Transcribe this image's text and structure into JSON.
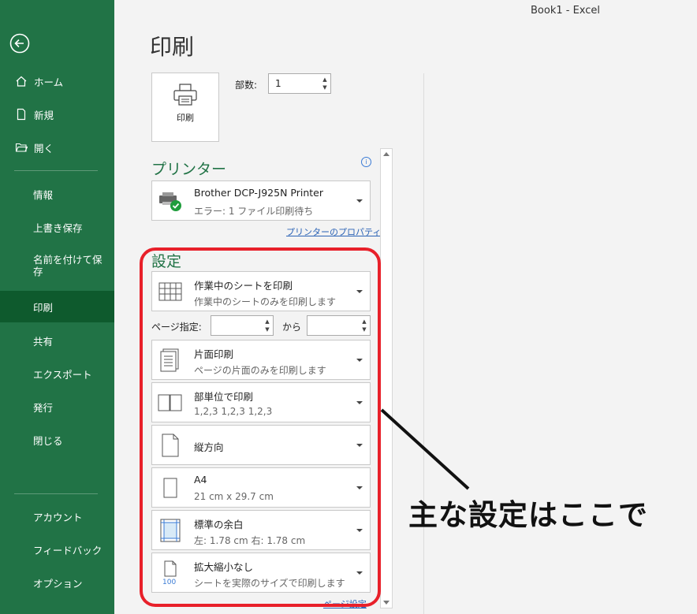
{
  "window": {
    "title": "Book1  -  Excel"
  },
  "sidebar": {
    "items": [
      {
        "label": "ホーム",
        "icon": "home-icon"
      },
      {
        "label": "新規",
        "icon": "new-document-icon"
      },
      {
        "label": "開く",
        "icon": "open-folder-icon"
      },
      {
        "label": "情報"
      },
      {
        "label": "上書き保存"
      },
      {
        "label": "名前を付けて保存"
      },
      {
        "label": "印刷"
      },
      {
        "label": "共有"
      },
      {
        "label": "エクスポート"
      },
      {
        "label": "発行"
      },
      {
        "label": "閉じる"
      },
      {
        "label": "アカウント"
      },
      {
        "label": "フィードバック"
      },
      {
        "label": "オプション"
      }
    ],
    "active": "印刷"
  },
  "page_title": "印刷",
  "print_button": {
    "label": "印刷"
  },
  "copies": {
    "label": "部数:",
    "value": "1"
  },
  "printer": {
    "section_title": "プリンター",
    "name": "Brother DCP-J925N Printer",
    "status": "エラー: 1 ファイル印刷待ち",
    "properties_link": "プリンターのプロパティ"
  },
  "settings": {
    "section_title": "設定",
    "what_to_print": {
      "title": "作業中のシートを印刷",
      "subtitle": "作業中のシートのみを印刷します"
    },
    "pages": {
      "label": "ページ指定:",
      "to_label": "から",
      "from_value": "",
      "to_value": ""
    },
    "sides": {
      "title": "片面印刷",
      "subtitle": "ページの片面のみを印刷します"
    },
    "collation": {
      "title": "部単位で印刷",
      "subtitle": "1,2,3    1,2,3    1,2,3"
    },
    "orientation": {
      "title": "縦方向"
    },
    "paper": {
      "title": "A4",
      "subtitle": "21 cm x 29.7 cm"
    },
    "margins": {
      "title": "標準の余白",
      "subtitle": "左:  1.78 cm    右:  1.78 cm"
    },
    "scaling": {
      "title": "拡大縮小なし",
      "subtitle": "シートを実際のサイズで印刷します"
    },
    "page_setup_link": "ページ設定"
  },
  "annotation": {
    "text": "主な設定はここで",
    "highlight_color": "#e8202a"
  },
  "colors": {
    "accent": "#217346",
    "active": "#0e5a2d",
    "link": "#2a62b5"
  }
}
